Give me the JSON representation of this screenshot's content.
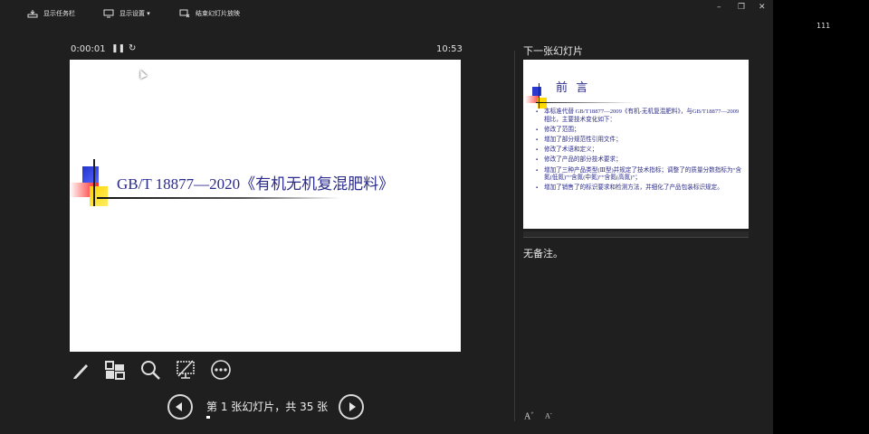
{
  "toolbar": {
    "show_taskbar": "显示任务栏",
    "display_settings": "显示设置 ▾",
    "end_slideshow": "结束幻灯片放映"
  },
  "window": {
    "minimize": "–",
    "restore": "❐",
    "close": "✕"
  },
  "side_strip_text": "111",
  "timer": {
    "elapsed": "0:00:01",
    "pause": "❚❚",
    "reset": "↻",
    "clock": "10:53"
  },
  "current_slide": {
    "title": "GB/T 18877—2020《有机无机复混肥料》"
  },
  "navigation": {
    "counter": "第 1 张幻灯片，共 35 张",
    "current": 1,
    "total": 35
  },
  "next_slide": {
    "label": "下一张幻灯片",
    "title": "前 言",
    "bullets": [
      "本标准代替 GB/T18877—2009《有机-无机复混肥料》，与GB/T18877—2009相比，主要技术变化如下：",
      "修改了范围；",
      "增加了部分规范性引用文件；",
      "修改了术语和定义；",
      "修改了产品的部分技术要求；",
      "增加了三种产品类型(Ⅲ型)并规定了技术指标；调整了的质量分数指标为“含氮(低氮)”“含氮(中氮)”“含氮(高氮)”；",
      "增加了销售了的标识要求和检测方法，并细化了产品包装标识规定。"
    ]
  },
  "notes": "无备注。",
  "font_controls": {
    "increase": "A",
    "decrease": "A"
  },
  "colors": {
    "background": "#1f1f1f",
    "slide_title": "#2b2b8c",
    "accent_blue": "#2233cc",
    "accent_red": "#ff5a5a",
    "accent_yellow": "#ffd500"
  }
}
